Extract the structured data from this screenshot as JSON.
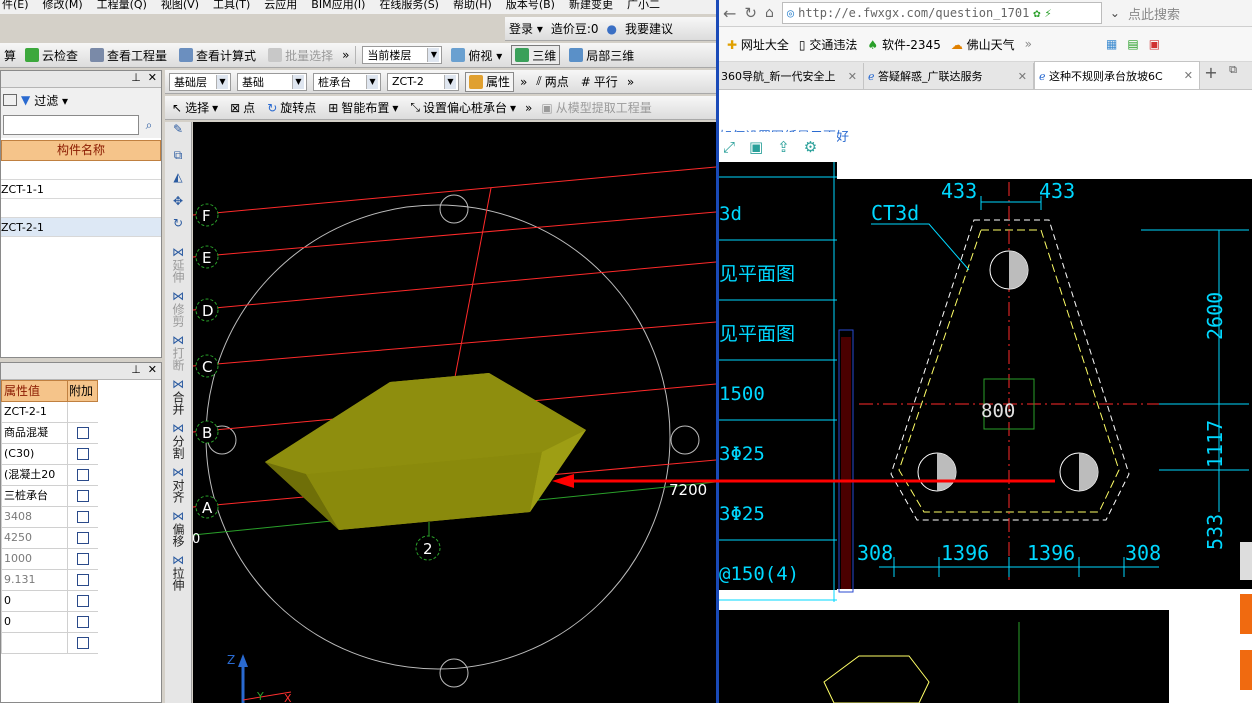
{
  "menu": [
    "件(E)",
    "修改(M)",
    "工程量(Q)",
    "视图(V)",
    "工具(T)",
    "云应用",
    "BIM应用(I)",
    "在线服务(S)",
    "帮助(H)",
    "版本号(B)",
    "新建变更",
    "广小二"
  ],
  "login_bar": {
    "login": "登录 ▾",
    "price": "造价豆:0",
    "suggest": "我要建议"
  },
  "toolbar1": [
    "算",
    "云检查",
    "查看工程量",
    "查看计算式",
    "批量选择"
  ],
  "toolbar1_right": {
    "floor": "当前楼层",
    "view": "俯视 ▾",
    "three_d": "三维",
    "local_3d": "局部三维"
  },
  "toolbar2": {
    "layer": "基础层",
    "category": "基础",
    "type": "桩承台",
    "item": "ZCT-2",
    "props": "属性",
    "two_point": "两点",
    "parallel": "平行"
  },
  "toolbar3": {
    "select": "选择",
    "point": "点",
    "rotate_point": "旋转点",
    "smart_layout": "智能布置",
    "eccentric": "设置偏心桩承台",
    "extract": "从模型提取工程量"
  },
  "left_panel": {
    "filter": "过滤 ▾",
    "col_header": "构件名称",
    "items": [
      "",
      "ZCT-1-1",
      "",
      "ZCT-2-1"
    ]
  },
  "prop_panel": {
    "headers": [
      "属性值",
      "附加"
    ],
    "rows": [
      "ZCT-2-1",
      "商品混凝",
      "(C30)",
      "(混凝土20",
      "三桩承台",
      "3408",
      "4250",
      "1000",
      "9.131",
      "0",
      "0",
      ""
    ]
  },
  "vtools": [
    "延伸",
    "修剪",
    "打断",
    "合并",
    "分割",
    "对齐",
    "偏移",
    "拉伸"
  ],
  "viewport": {
    "axis_letters": [
      "F",
      "E",
      "D",
      "C",
      "B",
      "A"
    ],
    "axis_number": "2",
    "dim": "7200",
    "zero": "0",
    "z_label": "Z",
    "y_label": "Y",
    "x_label": "X"
  },
  "browser": {
    "url": "http://e.fwxgx.com/question_1701",
    "search": "点此搜索",
    "bookmarks": [
      "网址大全",
      "交通违法",
      "软件-2345",
      "佛山天气"
    ],
    "tabs": [
      "360导航_新一代安全上",
      "答疑解惑_广联达服务",
      "这种不规则承台放坡6C"
    ],
    "page_link": "如何设置图纸显示更好"
  },
  "drawing": {
    "labels": [
      "3d",
      "见平面图",
      "见平面图",
      "1500",
      "3Φ25",
      "3Φ25",
      "@150(4)"
    ],
    "ct": "CT3d",
    "top_dims": [
      "433",
      "433"
    ],
    "right_dims": [
      "2600",
      "1117",
      "533"
    ],
    "center": "800",
    "bottom_dims": [
      "308",
      "1396",
      "1396",
      "308"
    ]
  },
  "colors": {
    "accent": "#ff0000",
    "cad_cyan": "#00d8ff",
    "cad_yellow": "#ffff66",
    "solid": "#8a8a10"
  }
}
